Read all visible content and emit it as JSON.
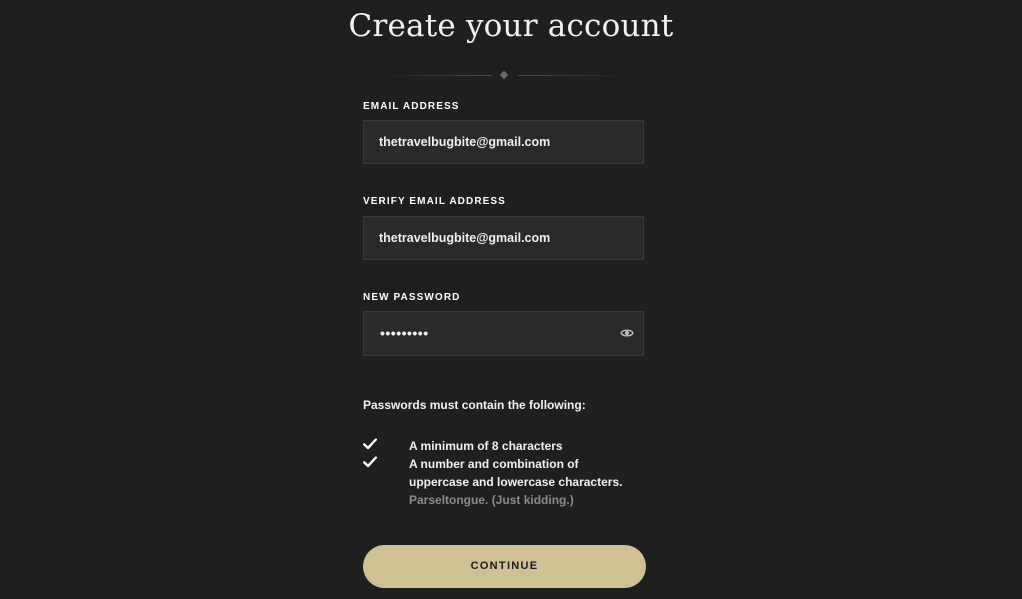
{
  "header": {
    "title": "Create your account"
  },
  "form": {
    "email": {
      "label": "EMAIL ADDRESS",
      "value": "thetravelbugbite@gmail.com"
    },
    "verify_email": {
      "label": "VERIFY EMAIL ADDRESS",
      "value": "thetravelbugbite@gmail.com"
    },
    "password": {
      "label": "NEW PASSWORD",
      "masked_value": "•••••••••",
      "toggle_icon": "eye-icon"
    }
  },
  "requirements": {
    "heading": "Passwords must contain the following:",
    "items": [
      {
        "icon": "checkmark-icon",
        "lines": [
          "A minimum of 8 characters"
        ]
      },
      {
        "icon": "checkmark-icon",
        "lines": [
          "A number and combination of",
          "uppercase and lowercase characters."
        ]
      }
    ],
    "joke": "Parseltongue. (Just kidding.)"
  },
  "actions": {
    "continue_label": "CONTINUE"
  },
  "colors": {
    "background": "#1f1f1f",
    "input_background": "#2a2a2a",
    "button": "#d0c195",
    "muted_text": "#8a8a8a"
  }
}
